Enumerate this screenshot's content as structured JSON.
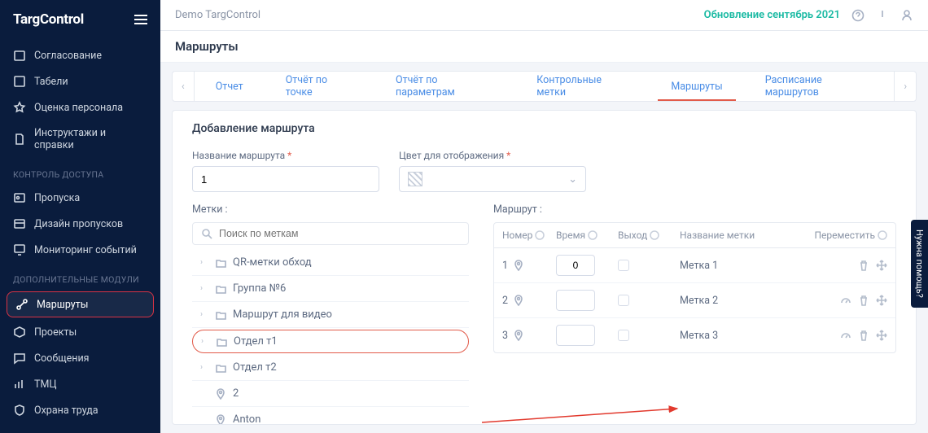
{
  "logo": "TargControl",
  "topbar": {
    "demo": "Demo TargControl",
    "update": "Обновление сентябрь 2021"
  },
  "sidebar": {
    "items_top": [
      {
        "label": "Согласование"
      },
      {
        "label": "Табели"
      },
      {
        "label": "Оценка персонала"
      },
      {
        "label": "Инструктажи и справки"
      }
    ],
    "section1": "КОНТРОЛЬ ДОСТУПА",
    "items_access": [
      {
        "label": "Пропуска"
      },
      {
        "label": "Дизайн пропусков"
      },
      {
        "label": "Мониторинг событий"
      }
    ],
    "section2": "ДОПОЛНИТЕЛЬНЫЕ МОДУЛИ",
    "items_extra": [
      {
        "label": "Маршруты"
      },
      {
        "label": "Проекты"
      },
      {
        "label": "Сообщения"
      },
      {
        "label": "ТМЦ"
      },
      {
        "label": "Охрана труда"
      }
    ]
  },
  "page_title": "Маршруты",
  "tabs": [
    "Отчет",
    "Отчёт по точке",
    "Отчёт по параметрам",
    "Контрольные метки",
    "Маршруты",
    "Расписание маршрутов"
  ],
  "panel_title": "Добавление маршрута",
  "form": {
    "name_label": "Название маршрута",
    "name_value": "1",
    "color_label": "Цвет для отображения"
  },
  "labels": {
    "tags": "Метки :",
    "route": "Маршрут :"
  },
  "search_placeholder": "Поиск по меткам",
  "tree": [
    {
      "type": "folder",
      "label": "QR-метки обход"
    },
    {
      "type": "folder",
      "label": "Группа №6"
    },
    {
      "type": "folder",
      "label": "Маршрут для видео"
    },
    {
      "type": "folder",
      "label": "Отдел т1",
      "hl": true
    },
    {
      "type": "folder",
      "label": "Отдел т2"
    },
    {
      "type": "pin",
      "label": "2"
    },
    {
      "type": "pin",
      "label": "Anton"
    }
  ],
  "route_head": {
    "num": "Номер",
    "time": "Время",
    "exit": "Выход",
    "name": "Название метки",
    "move": "Переместить"
  },
  "route_rows": [
    {
      "num": "1",
      "time": "0",
      "name": "Метка 1",
      "gauge": false
    },
    {
      "num": "2",
      "time": "",
      "name": "Метка 2",
      "gauge": true
    },
    {
      "num": "3",
      "time": "",
      "name": "Метка 3",
      "gauge": true
    }
  ],
  "help": "Нужна помощь?"
}
